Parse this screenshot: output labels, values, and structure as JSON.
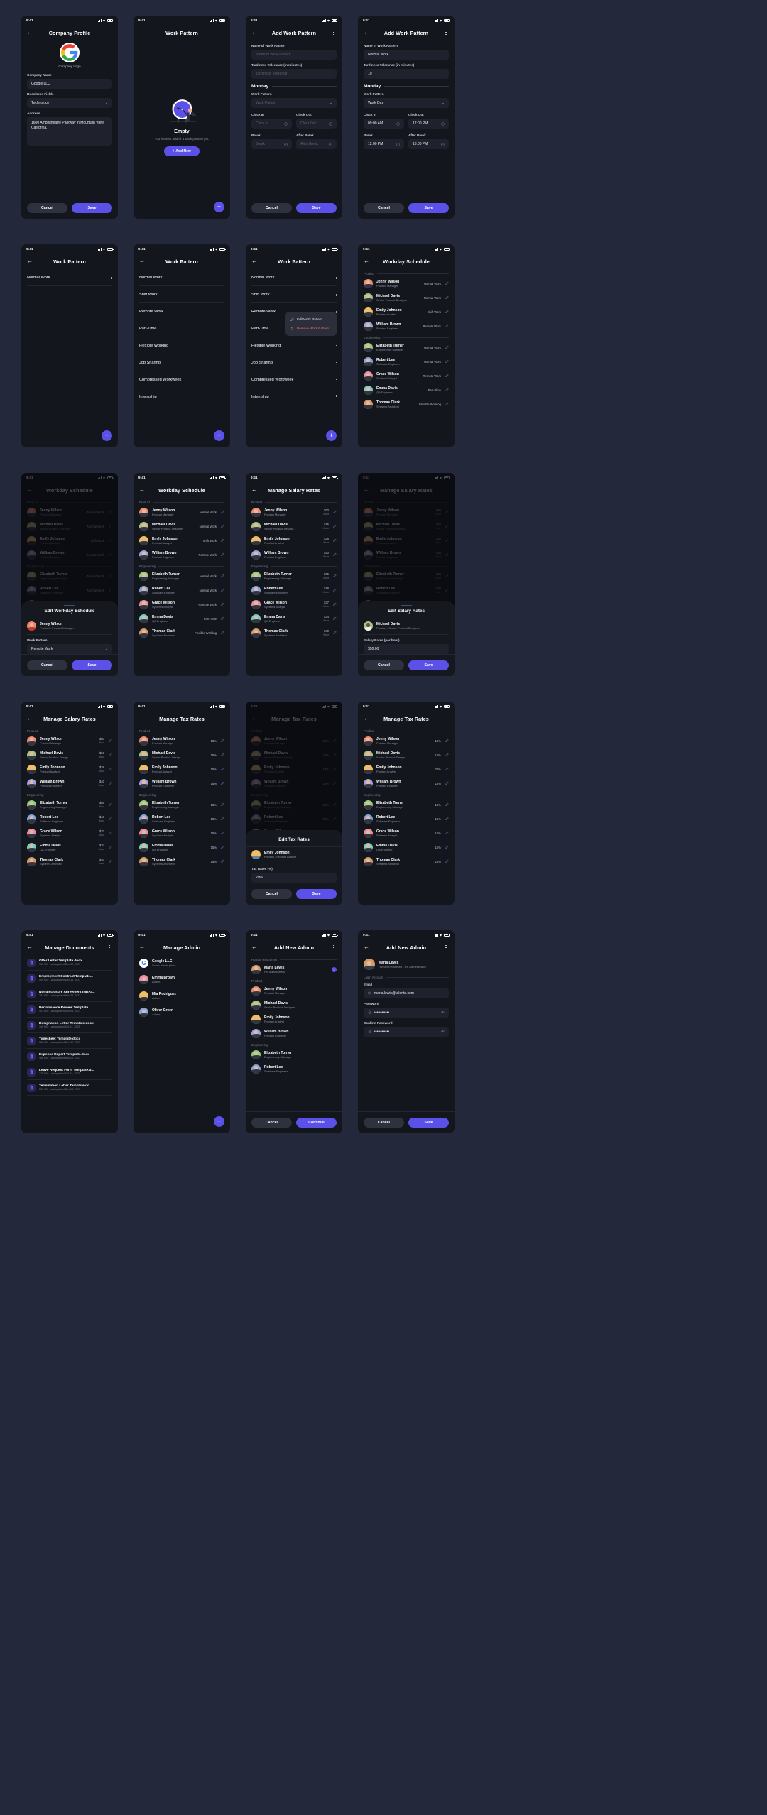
{
  "status_bar": {
    "time": "9:41"
  },
  "colors": {
    "accent": "#5b51e8",
    "bg": "#14161d",
    "field": "#1f222c",
    "page": "#23293a",
    "danger": "#f16a6a"
  },
  "icons": {
    "back": "arrow-left-icon",
    "kebab": "more-vertical-icon",
    "chevron": "chevron-down-icon",
    "clock": "clock-icon",
    "edit": "pencil-icon",
    "plus": "plus-icon",
    "doc": "document-icon",
    "check": "check-icon",
    "lock": "lock-icon",
    "eye": "eye-icon",
    "mail": "mail-icon"
  },
  "screens": {
    "company_profile": {
      "title": "Company Profile",
      "logo_caption": "Company Logo",
      "logo_letter": "G",
      "fields": [
        {
          "label": "Company Name",
          "value": "Google LLC"
        },
        {
          "label": "Bussiness Fields",
          "value": "Technology"
        },
        {
          "label": "Address",
          "value": "1600 Amphitheatre Parkway in Mountain View, California."
        }
      ],
      "cancel": "Cancel",
      "save": "Save"
    },
    "work_pattern_empty": {
      "title": "Work Pattern",
      "headline": "Empty",
      "subtext": "You haven't added a work pattern yet.",
      "add_label": "Add New"
    },
    "add_work_pattern_empty": {
      "title": "Add Work Pattern",
      "name_label": "Name of Work Pattern",
      "name_placeholder": "Name of Work Pattern",
      "tardiness_label": "Tardiness Tolerance (in minutes)",
      "tardiness_placeholder": "Tardiness Tolerance",
      "day": "Monday",
      "pattern_label": "Work Pattern",
      "pattern_placeholder": "Work Pattern",
      "clockin_label": "Clock In",
      "clockin_placeholder": "Clock In",
      "clockout_label": "Clock Out",
      "clockout_placeholder": "Clock Out",
      "break_label": "Break",
      "break_placeholder": "Break",
      "afterbreak_label": "After Break",
      "afterbreak_placeholder": "After Break",
      "cancel": "Cancel",
      "save": "Save"
    },
    "add_work_pattern_filled": {
      "title": "Add Work Pattern",
      "name_label": "Name of Work Pattern",
      "name_value": "Normal Work",
      "tardiness_label": "Tardiness Tolerance (in minutes)",
      "tardiness_value": "10",
      "day": "Monday",
      "pattern_label": "Work Pattern",
      "pattern_value": "Work Day",
      "clockin_label": "Clock In",
      "clockin_value": "09:00 AM",
      "clockout_label": "Clock Out",
      "clockout_value": "17:00 PM",
      "break_label": "Break",
      "break_value": "12:00 PM",
      "afterbreak_label": "After Break",
      "afterbreak_value": "13:00 PM",
      "cancel": "Cancel",
      "save": "Save"
    },
    "work_pattern_single": {
      "title": "Work Pattern",
      "items": [
        "Normal Work"
      ]
    },
    "work_pattern_list": {
      "title": "Work Pattern",
      "items": [
        "Normal Work",
        "Shift Work",
        "Remote Work",
        "Part-Time",
        "Flexible Working",
        "Job Sharing",
        "Compressed Workweek",
        "Internship"
      ]
    },
    "work_pattern_menu": {
      "title": "Work Pattern",
      "items": [
        "Normal Work",
        "Shift Work",
        "Remote Work",
        "Part-Time",
        "Flexible Working",
        "Job Sharing",
        "Compressed Workweek",
        "Internship"
      ],
      "menu": {
        "edit": "Edit Work Pattern",
        "remove": "Remove Work Pattern"
      }
    },
    "workday_schedule": {
      "title": "Workday Schedule",
      "groups": [
        {
          "name": "Product",
          "people": [
            {
              "name": "Jenny Wilson",
              "role": "Product Manager",
              "value": "Normal Work",
              "color": "#f08b6f"
            },
            {
              "name": "Michael Davis",
              "role": "Senior Product Designer",
              "value": "Normal Work",
              "color": "#a5c48a"
            },
            {
              "name": "Emily Johnson",
              "role": "Product Analyst",
              "value": "Shift Work",
              "color": "#f2c14e"
            },
            {
              "name": "William Brown",
              "role": "Product Engineer",
              "value": "Remote Work",
              "color": "#9aa2e8"
            }
          ]
        },
        {
          "name": "Engineering",
          "people": [
            {
              "name": "Elizabeth Turner",
              "role": "Engineering Manager",
              "value": "Normal Work",
              "color": "#8ed17c"
            },
            {
              "name": "Robert Lee",
              "role": "Software Engineer",
              "value": "Normal Work",
              "color": "#7fa6e0"
            },
            {
              "name": "Grace Wilson",
              "role": "Systems Analyst",
              "value": "Remote Work",
              "color": "#e88fa8"
            },
            {
              "name": "Emma Davis",
              "role": "QA Engineer",
              "value": "Part-Time",
              "color": "#6fd0c8"
            },
            {
              "name": "Thomas Clark",
              "role": "Systems Architect",
              "value": "Flexible Working",
              "color": "#d49a6a"
            }
          ]
        }
      ]
    },
    "edit_workday_schedule": {
      "title": "Edit Workday Schedule",
      "person": {
        "name": "Jenny Wilson",
        "role": "Product - Product Manager",
        "color": "#f08b6f"
      },
      "pattern_label": "Work Pattern",
      "pattern_value": "Remote Work",
      "cancel": "Cancel",
      "save": "Save"
    },
    "manage_salary_rates": {
      "title": "Manage Salary Rates",
      "unit": "/hour",
      "groups": [
        {
          "name": "Product",
          "people": [
            {
              "name": "Jenny Wilson",
              "role": "Product Manager",
              "value": "$60",
              "color": "#f08b6f"
            },
            {
              "name": "Michael Davis",
              "role": "Senior Product Design...",
              "value": "$45",
              "color": "#a5c48a"
            },
            {
              "name": "Emily Johnson",
              "role": "Product Analyst",
              "value": "$38",
              "color": "#f2c14e"
            },
            {
              "name": "William Brown",
              "role": "Product Engineer",
              "value": "$40",
              "color": "#9aa2e8"
            }
          ]
        },
        {
          "name": "Engineering",
          "people": [
            {
              "name": "Elizabeth Turner",
              "role": "Engineering Manager",
              "value": "$65",
              "color": "#8ed17c"
            },
            {
              "name": "Robert Lee",
              "role": "Software Engineer",
              "value": "$48",
              "color": "#7fa6e0"
            },
            {
              "name": "Grace Wilson",
              "role": "Systems Analyst",
              "value": "$37",
              "color": "#e88fa8"
            },
            {
              "name": "Emma Davis",
              "role": "QA Engineer",
              "value": "$34",
              "color": "#6fd0c8"
            },
            {
              "name": "Thomas Clark",
              "role": "Systems Architect",
              "value": "$40",
              "color": "#d49a6a"
            }
          ]
        }
      ]
    },
    "manage_salary_rates_alt": {
      "title": "Manage Salary Rates",
      "unit": "/hour",
      "groups": [
        {
          "name": "Product",
          "people": [
            {
              "name": "Jenny Wilson",
              "role": "Product Manager",
              "value": "$60",
              "color": "#f08b6f"
            },
            {
              "name": "Michael Davis",
              "role": "Senior Product Design...",
              "value": "$50",
              "color": "#a5c48a"
            },
            {
              "name": "Emily Johnson",
              "role": "Product Analyst",
              "value": "$38",
              "color": "#f2c14e"
            },
            {
              "name": "William Brown",
              "role": "Product Engineer",
              "value": "$40",
              "color": "#9aa2e8"
            }
          ]
        },
        {
          "name": "Engineering",
          "people": [
            {
              "name": "Elizabeth Turner",
              "role": "Engineering Manager",
              "value": "$65",
              "color": "#8ed17c"
            },
            {
              "name": "Robert Lee",
              "role": "Software Engineer",
              "value": "$48",
              "color": "#7fa6e0"
            },
            {
              "name": "Grace Wilson",
              "role": "Systems Analyst",
              "value": "$37",
              "color": "#e88fa8"
            },
            {
              "name": "Emma Davis",
              "role": "QA Engineer",
              "value": "$34",
              "color": "#6fd0c8"
            },
            {
              "name": "Thomas Clark",
              "role": "Systems Architect",
              "value": "$40",
              "color": "#d49a6a"
            }
          ]
        }
      ]
    },
    "edit_salary_rates": {
      "title": "Edit Salary Rates",
      "person": {
        "name": "Michael Davis",
        "role": "Product - Senior Product Designer",
        "color": "#a5c48a"
      },
      "rate_label": "Salary Rates (per hour)",
      "rate_value": "$50.00",
      "cancel": "Cancel",
      "save": "Save"
    },
    "manage_tax_rates": {
      "title": "Manage Tax Rates",
      "groups": [
        {
          "name": "Product",
          "people": [
            {
              "name": "Jenny Wilson",
              "role": "Product Manager",
              "value": "15%",
              "color": "#f08b6f"
            },
            {
              "name": "Michael Davis",
              "role": "Senior Product Design...",
              "value": "15%",
              "color": "#a5c48a"
            },
            {
              "name": "Emily Johnson",
              "role": "Product Analyst",
              "value": "15%",
              "color": "#f2c14e"
            },
            {
              "name": "William Brown",
              "role": "Product Engineer",
              "value": "15%",
              "color": "#9aa2e8"
            }
          ]
        },
        {
          "name": "Engineering",
          "people": [
            {
              "name": "Elizabeth Turner",
              "role": "Engineering Manager",
              "value": "15%",
              "color": "#8ed17c"
            },
            {
              "name": "Robert Lee",
              "role": "Software Engineer",
              "value": "15%",
              "color": "#7fa6e0"
            },
            {
              "name": "Grace Wilson",
              "role": "Systems Analyst",
              "value": "15%",
              "color": "#e88fa8"
            },
            {
              "name": "Emma Davis",
              "role": "QA Engineer",
              "value": "15%",
              "color": "#6fd0c8"
            },
            {
              "name": "Thomas Clark",
              "role": "Systems Architect",
              "value": "15%",
              "color": "#d49a6a"
            }
          ]
        }
      ]
    },
    "manage_tax_rates_alt": {
      "title": "Manage Tax Rates",
      "groups": [
        {
          "name": "Product",
          "people": [
            {
              "name": "Jenny Wilson",
              "role": "Product Manager",
              "value": "15%",
              "color": "#f08b6f"
            },
            {
              "name": "Michael Davis",
              "role": "Senior Product Design...",
              "value": "15%",
              "color": "#a5c48a"
            },
            {
              "name": "Emily Johnson",
              "role": "Product Analyst",
              "value": "20%",
              "color": "#f2c14e"
            },
            {
              "name": "William Brown",
              "role": "Product Engineer",
              "value": "15%",
              "color": "#9aa2e8"
            }
          ]
        },
        {
          "name": "Engineering",
          "people": [
            {
              "name": "Elizabeth Turner",
              "role": "Engineering Manager",
              "value": "15%",
              "color": "#8ed17c"
            },
            {
              "name": "Robert Lee",
              "role": "Software Engineer",
              "value": "15%",
              "color": "#7fa6e0"
            },
            {
              "name": "Grace Wilson",
              "role": "Systems Analyst",
              "value": "15%",
              "color": "#e88fa8"
            },
            {
              "name": "Emma Davis",
              "role": "QA Engineer",
              "value": "15%",
              "color": "#6fd0c8"
            },
            {
              "name": "Thomas Clark",
              "role": "Systems Architect",
              "value": "15%",
              "color": "#d49a6a"
            }
          ]
        }
      ]
    },
    "edit_tax_rates": {
      "title": "Edit Tax Rates",
      "person": {
        "name": "Emily Johnson",
        "role": "Product - Product Analyst",
        "color": "#f2c14e"
      },
      "rate_label": "Tax Rates (%)",
      "rate_value": "20%",
      "cancel": "Cancel",
      "save": "Save"
    },
    "manage_documents": {
      "title": "Manage Documents",
      "documents": [
        {
          "name": "Offer Letter Template.docx",
          "meta": "350 KB  ·  Last updated Dec 10, 2023"
        },
        {
          "name": "Employment Contract Template...",
          "meta": "500 KB  ·  Last updated Dec 14, 2023"
        },
        {
          "name": "Nondisclosure Agreement (NDA)...",
          "meta": "287 KB  ·  Last updated Nov 29, 2023"
        },
        {
          "name": "Performance Review Template...",
          "meta": "402 KB  ·  Last updated Dec 05, 2023"
        },
        {
          "name": "Resignation Letter Template.docx",
          "meta": "349 KB  ·  Last updated Oct 14, 2023"
        },
        {
          "name": "Timesheet Template.docx",
          "meta": "582 KB  ·  Last updated Dec 17, 2023"
        },
        {
          "name": "Expense Report Template.docx",
          "meta": "466 KB  ·  Last updated Nov 21, 2023"
        },
        {
          "name": "Leave Request Form Template.d...",
          "meta": "275 KB  ·  Last updated Oct 12, 2023"
        },
        {
          "name": "Termination Letter Template.do...",
          "meta": "530 KB  ·  Last updated Dec 08, 2023"
        }
      ]
    },
    "manage_admin": {
      "title": "Manage Admin",
      "admins": [
        {
          "name": "Google LLC",
          "role": "Super Admin (You)",
          "color": "#ffffff",
          "letter": "G"
        },
        {
          "name": "Emma Brown",
          "role": "Admin",
          "color": "#e88fa8"
        },
        {
          "name": "Mia Rodriguez",
          "role": "Admin",
          "color": "#f2c14e"
        },
        {
          "name": "Oliver Green",
          "role": "Admin",
          "color": "#7fa6e0"
        }
      ]
    },
    "add_new_admin_select": {
      "title": "Add New Admin",
      "groups": [
        {
          "name": "Human Resources",
          "people": [
            {
              "name": "Maria Lewis",
              "role": "HR Administrator",
              "color": "#d49a6a",
              "selected": true
            }
          ]
        },
        {
          "name": "Product",
          "people": [
            {
              "name": "Jenny Wilson",
              "role": "Product Manager",
              "color": "#f08b6f"
            },
            {
              "name": "Michael Davis",
              "role": "Senior Product Designer",
              "color": "#a5c48a"
            },
            {
              "name": "Emily Johnson",
              "role": "Product Analyst",
              "color": "#f2c14e"
            },
            {
              "name": "William Brown",
              "role": "Product Engineer",
              "color": "#9aa2e8"
            }
          ]
        },
        {
          "name": "Engineering",
          "people": [
            {
              "name": "Elizabeth Turner",
              "role": "Engineering Manager",
              "color": "#8ed17c"
            },
            {
              "name": "Robert Lee",
              "role": "Software Engineer",
              "color": "#7fa6e0"
            }
          ]
        }
      ],
      "cancel": "Cancel",
      "continue": "Continue"
    },
    "add_new_admin_form": {
      "title": "Add New Admin",
      "person": {
        "name": "Maria Lewis",
        "role": "Human Resources - HR Administrator",
        "color": "#d49a6a"
      },
      "section": "Login Account",
      "email_label": "Email",
      "email_value": "maria.lewis@talento.com",
      "password_label": "Password",
      "password_value": "••••••••••••",
      "confirm_label": "Confirm Password",
      "confirm_value": "••••••••••••",
      "cancel": "Cancel",
      "save": "Save"
    }
  }
}
